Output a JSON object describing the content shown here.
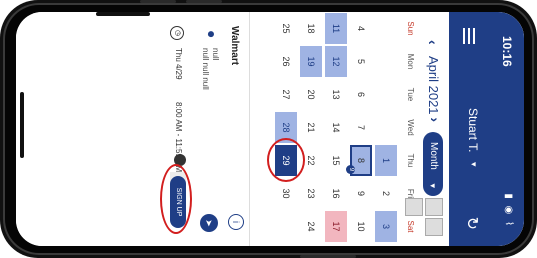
{
  "status": {
    "time": "10:16",
    "icons": "▮ ◉ ⌇"
  },
  "header": {
    "user": "Stuart T.",
    "user_caret": "▾",
    "refresh": "↻"
  },
  "calendar": {
    "prev": "‹",
    "title": "April 2021",
    "view_label": "Month",
    "view_caret": "▾",
    "next": "›",
    "weekdays": [
      "Sun",
      "Mon",
      "Tue",
      "Wed",
      "Thu",
      "Fri",
      "Sat"
    ],
    "weeks": [
      [
        "",
        "",
        "",
        "",
        "1",
        "2",
        "3"
      ],
      [
        "4",
        "5",
        "6",
        "7",
        "8",
        "9",
        "10"
      ],
      [
        "11",
        "12",
        "13",
        "14",
        "15",
        "16",
        "17"
      ],
      [
        "18",
        "19",
        "20",
        "21",
        "22",
        "23",
        "24"
      ],
      [
        "25",
        "26",
        "27",
        "28",
        "29",
        "30",
        ""
      ]
    ],
    "badge_day": "8",
    "badge_value": "9"
  },
  "store": {
    "name": "Walmart",
    "address_line1": "null",
    "address_line2": "null null null",
    "date": "Thu 4/29",
    "hours": "8:00 AM - 11:59 PM",
    "sign_up": "SIGN UP",
    "info": "i",
    "nav": "➤",
    "clock": "◷"
  },
  "colors": {
    "primary": "#1f3e86",
    "highlight": "#9fb3e3",
    "red_day": "#f2b6bf",
    "annotation": "#d21e1e"
  }
}
